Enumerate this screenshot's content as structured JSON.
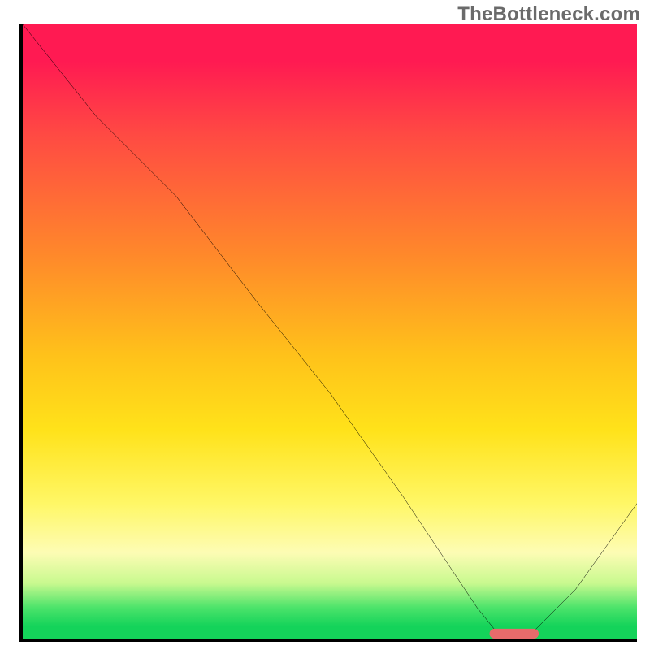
{
  "watermark": "TheBottleneck.com",
  "chart_data": {
    "type": "line",
    "title": "",
    "xlabel": "",
    "ylabel": "",
    "xlim": [
      0,
      100
    ],
    "ylim": [
      0,
      100
    ],
    "series": [
      {
        "name": "bottleneck-curve",
        "x": [
          0,
          12,
          25,
          38,
          50,
          62,
          74,
          78,
          82,
          90,
          100
        ],
        "y": [
          100,
          85,
          72,
          55,
          40,
          23,
          5,
          0,
          0,
          8,
          22
        ]
      }
    ],
    "marker": {
      "name": "optimal-range",
      "x_start": 76,
      "x_end": 84,
      "y": 0,
      "color": "#e76b6b"
    },
    "gradient_stops": [
      {
        "pos": 0.0,
        "color": "#ff1a52"
      },
      {
        "pos": 0.38,
        "color": "#ff8a2a"
      },
      {
        "pos": 0.66,
        "color": "#ffe21a"
      },
      {
        "pos": 0.86,
        "color": "#fdfcb4"
      },
      {
        "pos": 0.95,
        "color": "#4be36a"
      },
      {
        "pos": 1.0,
        "color": "#14d35a"
      }
    ]
  }
}
